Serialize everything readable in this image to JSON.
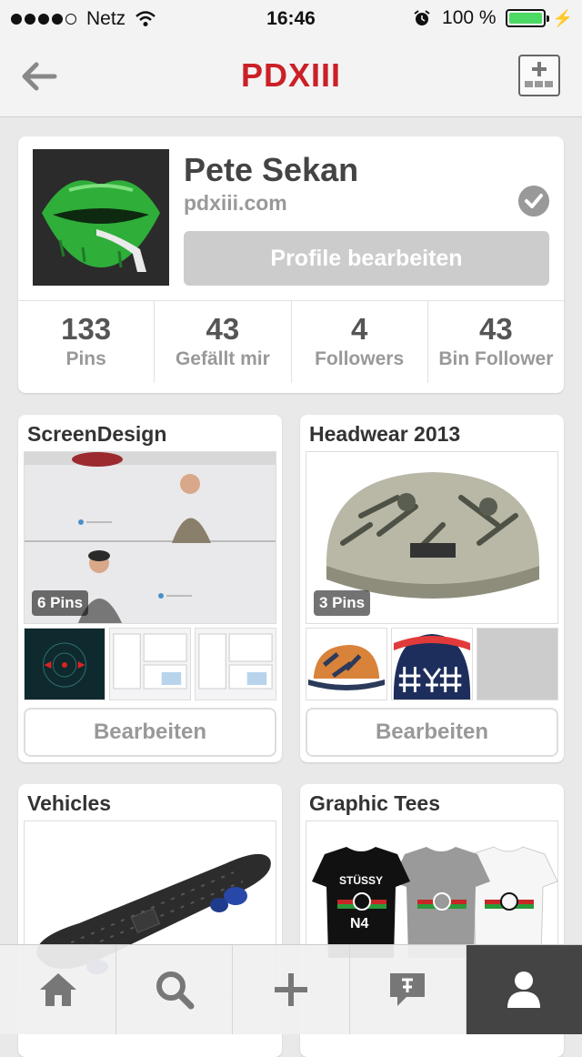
{
  "status_bar": {
    "carrier": "Netz",
    "time": "16:46",
    "battery": "100 %"
  },
  "nav": {
    "title": "PDXIII"
  },
  "profile": {
    "name": "Pete Sekan",
    "website": "pdxiii.com",
    "edit_label": "Profile bearbeiten",
    "stats": [
      {
        "value": "133",
        "label": "Pins"
      },
      {
        "value": "43",
        "label": "Gefällt mir"
      },
      {
        "value": "4",
        "label": "Followers"
      },
      {
        "value": "43",
        "label": "Bin Follower"
      }
    ]
  },
  "boards": [
    {
      "title": "ScreenDesign",
      "pins": "6 Pins",
      "edit_label": "Bearbeiten"
    },
    {
      "title": "Headwear 2013",
      "pins": "3 Pins",
      "edit_label": "Bearbeiten"
    },
    {
      "title": "Vehicles"
    },
    {
      "title": "Graphic Tees",
      "shirt_text": "STÜSSY",
      "shirt_code": "N4"
    }
  ],
  "colors": {
    "brand_red": "#cb2027",
    "battery_green": "#4cd964",
    "active_tab": "#444444"
  },
  "tabbar": {
    "icons": [
      "home-icon",
      "search-icon",
      "plus-icon",
      "notifications-icon",
      "profile-icon"
    ]
  }
}
